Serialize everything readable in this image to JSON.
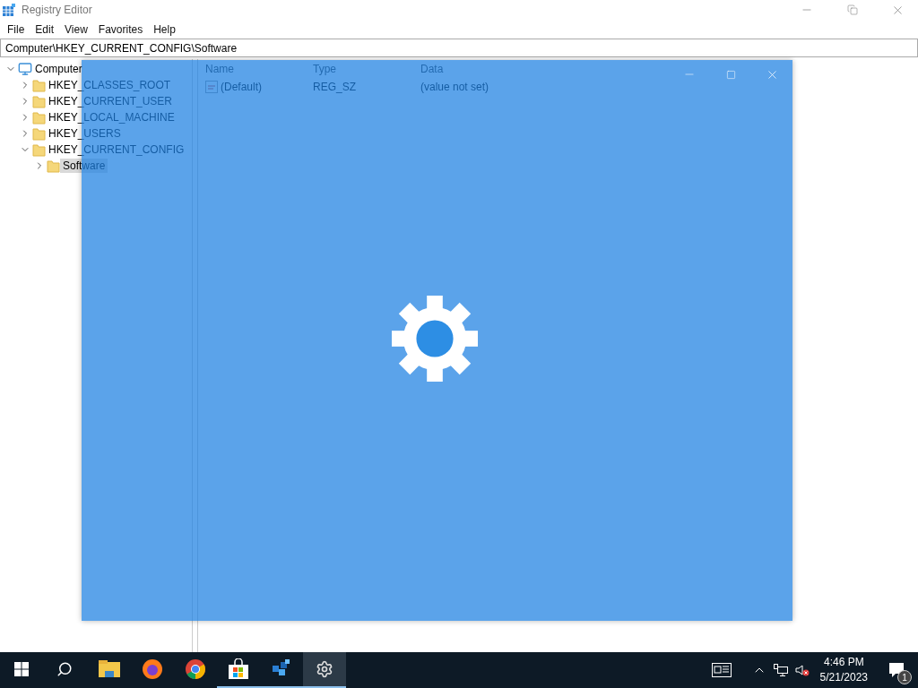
{
  "window": {
    "title": "Registry Editor"
  },
  "menu": [
    "File",
    "Edit",
    "View",
    "Favorites",
    "Help"
  ],
  "address": "Computer\\HKEY_CURRENT_CONFIG\\Software",
  "tree": [
    {
      "label": "Computer",
      "kind": "computer",
      "expanded": true,
      "selected": false,
      "children": [
        {
          "label": "HKEY_CLASSES_ROOT",
          "kind": "folder",
          "expanded": false,
          "selected": false
        },
        {
          "label": "HKEY_CURRENT_USER",
          "kind": "folder",
          "expanded": false,
          "selected": false
        },
        {
          "label": "HKEY_LOCAL_MACHINE",
          "kind": "folder",
          "expanded": false,
          "selected": false
        },
        {
          "label": "HKEY_USERS",
          "kind": "folder",
          "expanded": false,
          "selected": false
        },
        {
          "label": "HKEY_CURRENT_CONFIG",
          "kind": "folder",
          "expanded": true,
          "selected": false,
          "children": [
            {
              "label": "Software",
              "kind": "folder",
              "expanded": false,
              "selected": true
            }
          ]
        }
      ]
    }
  ],
  "list": {
    "columns": [
      "Name",
      "Type",
      "Data"
    ],
    "rows": [
      [
        "(Default)",
        "REG_SZ",
        "(value not set)"
      ]
    ]
  },
  "taskbar": {
    "apps": [
      {
        "kind": "explorer",
        "running": false,
        "active": false
      },
      {
        "kind": "firefox",
        "running": false,
        "active": false
      },
      {
        "kind": "chrome",
        "running": false,
        "active": false
      },
      {
        "kind": "store",
        "running": true,
        "active": false
      },
      {
        "kind": "regedit",
        "running": true,
        "active": false
      },
      {
        "kind": "settings",
        "running": true,
        "active": true
      }
    ],
    "time": "4:46 PM",
    "date": "5/21/2023",
    "notifications": "1"
  }
}
